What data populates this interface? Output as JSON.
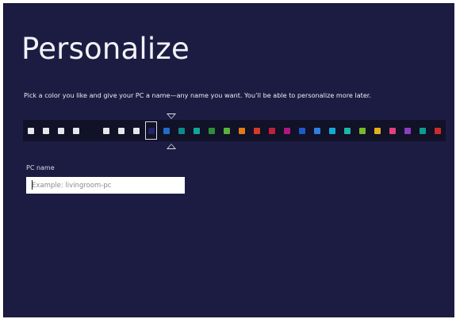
{
  "page": {
    "title": "Personalize",
    "subtitle": "Pick a color you like and give your PC a name—any name you want. You’ll be able to personalize more later."
  },
  "color_picker": {
    "selected_index": 8,
    "swatches": [
      {
        "name": "white-1",
        "color": "#e6e6ee"
      },
      {
        "name": "white-2",
        "color": "#e6e6ee"
      },
      {
        "name": "white-3",
        "color": "#e6e6ee"
      },
      {
        "name": "white-4",
        "color": "#e6e6ee"
      },
      {
        "name": "dark-1",
        "color": "#111128"
      },
      {
        "name": "white-5",
        "color": "#e6e6ee"
      },
      {
        "name": "white-6",
        "color": "#e6e6ee"
      },
      {
        "name": "white-7",
        "color": "#e6e6ee"
      },
      {
        "name": "navy-selected",
        "color": "#23236a"
      },
      {
        "name": "blue-1",
        "color": "#1f6fc7"
      },
      {
        "name": "teal-1",
        "color": "#0d8a8e"
      },
      {
        "name": "teal-2",
        "color": "#13a59a"
      },
      {
        "name": "green-1",
        "color": "#2e8f3a"
      },
      {
        "name": "green-2",
        "color": "#5ab13a"
      },
      {
        "name": "orange-1",
        "color": "#e07b16"
      },
      {
        "name": "red-1",
        "color": "#d23a2a"
      },
      {
        "name": "red-2",
        "color": "#c21e3e"
      },
      {
        "name": "magenta-1",
        "color": "#b0177e"
      },
      {
        "name": "blue-2",
        "color": "#1e59c8"
      },
      {
        "name": "blue-3",
        "color": "#2f7fe0"
      },
      {
        "name": "cyan-1",
        "color": "#16a8d6"
      },
      {
        "name": "teal-3",
        "color": "#1bb7a8"
      },
      {
        "name": "green-3",
        "color": "#78b82a"
      },
      {
        "name": "yellow-1",
        "color": "#e1b11c"
      },
      {
        "name": "pink-1",
        "color": "#e0407f"
      },
      {
        "name": "purple-1",
        "color": "#8a3fc0"
      },
      {
        "name": "teal-4",
        "color": "#0e9c8e"
      },
      {
        "name": "red-3",
        "color": "#cc2b2b"
      }
    ]
  },
  "pc_name": {
    "label": "PC name",
    "value": "",
    "placeholder": "Example: livingroom-pc"
  },
  "colors": {
    "background": "#1c1c43",
    "text": "#f2f2f7"
  }
}
